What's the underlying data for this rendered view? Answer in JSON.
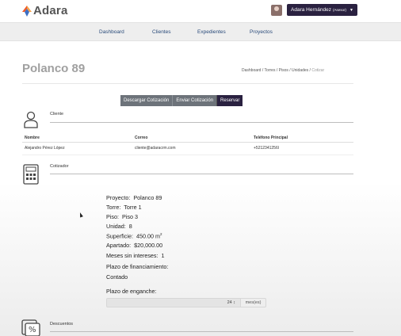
{
  "brand": {
    "name": "Adara"
  },
  "user": {
    "name": "Adara Hernández",
    "role": "(Asesor)"
  },
  "nav": [
    {
      "label": "Dashboard"
    },
    {
      "label": "Clientes"
    },
    {
      "label": "Expedientes"
    },
    {
      "label": "Proyectos"
    }
  ],
  "page": {
    "title": "Polanco 89"
  },
  "breadcrumb": [
    "Dashboard",
    "Torres",
    "Pisos",
    "Unidades",
    "Cotizar"
  ],
  "actions": {
    "download": "Descargar Cotización",
    "send": "Enviar Cotización",
    "reserve": "Reservar"
  },
  "cliente": {
    "section": "Cliente",
    "columns": [
      "Nombre",
      "Correo",
      "Teléfono Principal"
    ],
    "row": [
      "Alejandro Pérez López",
      "cliente@adaracrm.com",
      "+5212341256l"
    ]
  },
  "cotizador": {
    "section": "Cotizador",
    "proyecto_label": "Proyecto:",
    "proyecto": "Polanco 89",
    "torre_label": "Torre:",
    "torre": "Torre 1",
    "piso_label": "Piso:",
    "piso": "Piso 3",
    "unidad_label": "Unidad:",
    "unidad": "8",
    "superficie_label": "Superficie:",
    "superficie": "450.00 m",
    "superficie_sup": "2",
    "apartado_label": "Apartado:",
    "apartado": "$20,000.00",
    "msi_label": "Meses sin intereses:",
    "msi": "1",
    "plazo_label": "Plazo de financiamiento:",
    "plazo": "Contado",
    "enganche_label": "Plazo de enganche:",
    "enganche": "24",
    "enganche_unit": "mes(es)"
  },
  "descuentos": {
    "section": "Descuentos"
  },
  "colors": {
    "primary": "#2a2140",
    "brand_orange": "#f05a28",
    "brand_blue": "#3d6fc4",
    "nav_link": "#2a4b7a"
  }
}
